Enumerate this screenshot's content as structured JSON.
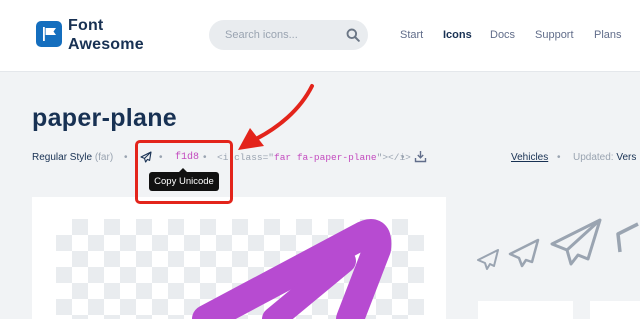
{
  "brand": {
    "name_line1": "Font",
    "name_line2": "Awesome",
    "color": "#146ebe"
  },
  "search": {
    "placeholder": "Search icons..."
  },
  "nav": [
    {
      "label": "Start"
    },
    {
      "label": "Icons",
      "active": true
    },
    {
      "label": "Docs"
    },
    {
      "label": "Support"
    },
    {
      "label": "Plans"
    }
  ],
  "icon": {
    "name": "paper-plane",
    "style_label": "Regular Style",
    "style_prefix": "(far)",
    "unicode": "f1d8",
    "code_open": "<i class=\"",
    "code_class": "far fa-paper-plane",
    "code_close": "\"></i>",
    "category": "Vehicles",
    "updated_label": "Updated:",
    "updated_value": "Vers"
  },
  "tooltip": {
    "text": "Copy Unicode"
  },
  "colors": {
    "accent": "#c34bbf",
    "annotation": "#e3241b",
    "text": "#183153",
    "muted": "#9aa4b1"
  }
}
